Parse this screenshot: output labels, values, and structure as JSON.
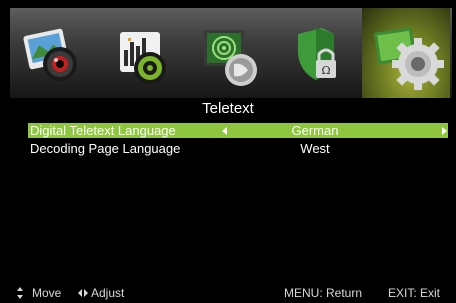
{
  "menu_icons": [
    {
      "name": "picture-icon",
      "selected": false
    },
    {
      "name": "sound-icon",
      "selected": false
    },
    {
      "name": "channel-icon",
      "selected": false
    },
    {
      "name": "lock-icon",
      "selected": false
    },
    {
      "name": "setup-icon",
      "selected": true
    }
  ],
  "page": {
    "title": "Teletext"
  },
  "settings": [
    {
      "label": "Digital Teletext Language",
      "value": "German",
      "highlighted": true
    },
    {
      "label": "Decoding Page Language",
      "value": "West",
      "highlighted": false
    }
  ],
  "help": {
    "move_label": "Move",
    "adjust_label": "Adjust",
    "menu_label": "MENU: Return",
    "exit_label": "EXIT: Exit"
  },
  "colors": {
    "highlight": "#8ec63f",
    "selected_icon_glow": "#aeb53c",
    "background": "#000000"
  }
}
